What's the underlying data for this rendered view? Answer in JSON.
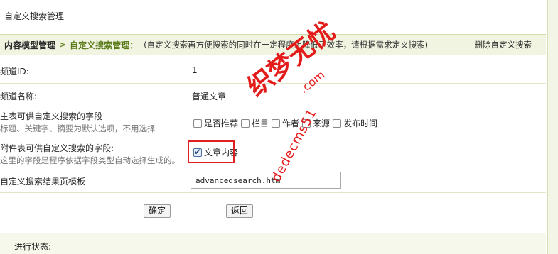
{
  "page": {
    "header_title": "自定义搜索管理"
  },
  "nav": {
    "crumb1": "内容模型管理",
    "arrow": ">",
    "crumb2": "自定义搜索管理：",
    "description": "(自定义搜索再方便搜索的同时在一定程度上降低了效率，请根据需求定义搜索)",
    "delete_label": "删除自定义搜索"
  },
  "form": {
    "channel_id": {
      "label": "频道ID:",
      "value": "1"
    },
    "channel_name": {
      "label": "频道名称:",
      "value": "普通文章"
    },
    "main_fields": {
      "label": "主表可供自定义搜索的字段",
      "sublabel": "标题、关键字、摘要为默认选项，不用选择",
      "options": [
        {
          "label": "是否推荐",
          "checked": false
        },
        {
          "label": "栏目",
          "checked": false
        },
        {
          "label": "作者",
          "checked": false
        },
        {
          "label": "来源",
          "checked": false
        },
        {
          "label": "发布时间",
          "checked": false
        }
      ]
    },
    "addon_fields": {
      "label": "附件表可供自定义搜索的字段:",
      "sublabel": "这里的字段是程序依据字段类型自动选择生成的。",
      "options": [
        {
          "label": "文章内容",
          "checked": true
        }
      ]
    },
    "template": {
      "label": "自定义搜索结果页模板",
      "value": "advancedsearch.htm"
    }
  },
  "buttons": {
    "confirm": "确定",
    "back": "返回"
  },
  "status": {
    "label": "进行状态:"
  },
  "watermark": {
    "line1": "织梦无忧",
    ".com_text": ".com",
    "domain": "dedecms51"
  },
  "colors": {
    "accent_green": "#5c7a1a",
    "nav_bg": "#f0f4e1",
    "highlight_red": "#e02020",
    "watermark_red": "#e41b1b"
  }
}
